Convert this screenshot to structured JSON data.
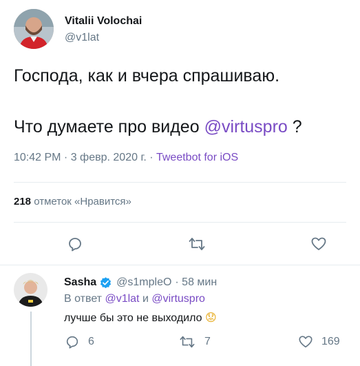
{
  "tweet": {
    "author_name": "Vitalii Volochai",
    "author_handle": "@v1lat",
    "text_line1": "Господа, как и вчера спрашиваю.",
    "text_line2_prefix": "Что думаете про видео ",
    "text_line2_mention": "@virtuspro",
    "text_line2_suffix": " ?",
    "meta_time": "10:42 PM · 3 февр. 2020 г. · ",
    "meta_source": "Tweetbot for iOS",
    "likes_count": "218",
    "likes_label": "отметок «Нравится»"
  },
  "reply": {
    "author_name": "Sasha",
    "author_handle": "@s1mpleO",
    "time": "· 58 мин",
    "reply_to_prefix": "В ответ ",
    "reply_to_user1": "@v1lat",
    "reply_to_and": " и ",
    "reply_to_user2": "@virtuspro",
    "text": "лучше бы это не выходило",
    "emoji": "😟",
    "replies_count": "6",
    "retweets_count": "7",
    "likes_count": "169"
  },
  "colors": {
    "accent": "#794bc4",
    "verified": "#1da1f2",
    "muted": "#657786",
    "divider": "#e6ecf0"
  },
  "icons": [
    "reply-icon",
    "retweet-icon",
    "like-icon",
    "verified-badge-icon"
  ]
}
